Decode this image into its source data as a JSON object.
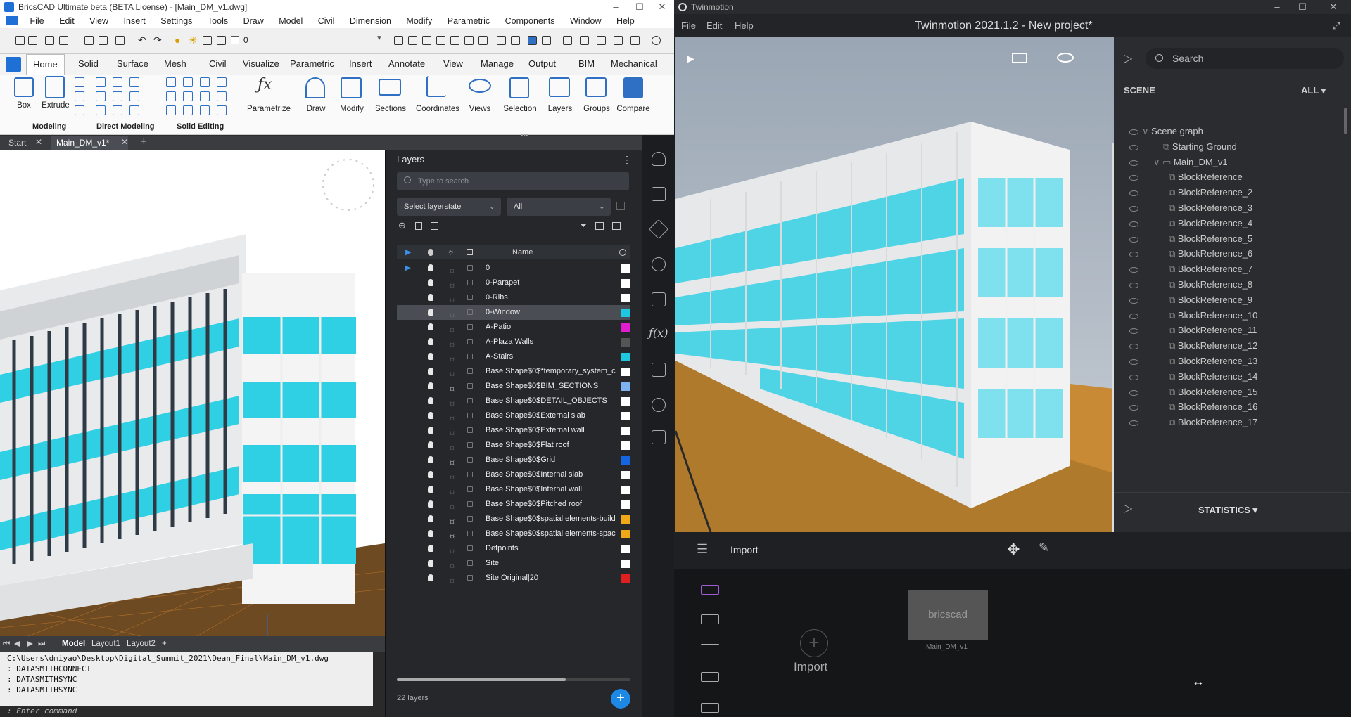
{
  "bricscad": {
    "title": "BricsCAD Ultimate beta (BETA License) - [Main_DM_v1.dwg]",
    "menu": [
      "File",
      "Edit",
      "View",
      "Insert",
      "Settings",
      "Tools",
      "Draw",
      "Model",
      "Civil",
      "Dimension",
      "Modify",
      "Parametric",
      "Components",
      "Window",
      "Help"
    ],
    "qat_layer": "0",
    "tabs": [
      "Home",
      "Solid",
      "Surface",
      "Mesh",
      "Civil",
      "Visualize",
      "Parametric",
      "Insert",
      "Annotate",
      "View",
      "Manage",
      "Output",
      "BIM",
      "Mechanical"
    ],
    "ribbon": {
      "box": "Box",
      "extrude": "Extrude",
      "parametrize": "Parametrize",
      "draw": "Draw",
      "modify": "Modify",
      "sections": "Sections",
      "coordinates": "Coordinates",
      "views": "Views",
      "selection": "Selection",
      "layers": "Layers",
      "groups": "Groups",
      "compare": "Compare",
      "group_modeling": "Modeling",
      "group_direct": "Direct Modeling",
      "group_solid": "Solid Editing"
    },
    "doc_tabs": [
      "Start",
      "Main_DM_v1*"
    ],
    "layout_tabs": [
      "Model",
      "Layout1",
      "Layout2"
    ],
    "command_history": [
      "C:\\Users\\dmiyao\\Desktop\\Digital_Summit_2021\\Dean_Final\\Main_DM_v1.dwg",
      ": DATASMITHCONNECT",
      ": DATASMITHSYNC",
      ": DATASMITHSYNC"
    ],
    "command_placeholder": ": Enter command"
  },
  "layers_panel": {
    "title": "Layers",
    "search_placeholder": "Type to search",
    "layerstate": "Select layerstate",
    "filter": "All",
    "name_header": "Name",
    "count": "22 layers",
    "rows": [
      {
        "name": "0",
        "color": "#ffffff",
        "frozen": false
      },
      {
        "name": "0-Parapet",
        "color": "#ffffff",
        "frozen": false
      },
      {
        "name": "0-Ribs",
        "color": "#ffffff",
        "frozen": false
      },
      {
        "name": "0-Window",
        "color": "#1ec8e0",
        "frozen": false,
        "selected": true
      },
      {
        "name": "A-Patio",
        "color": "#e01ed0",
        "frozen": false
      },
      {
        "name": "A-Plaza Walls",
        "color": "#555555",
        "frozen": false
      },
      {
        "name": "A-Stairs",
        "color": "#1ec8e0",
        "frozen": false
      },
      {
        "name": "Base Shape$0$*temporary_system_c",
        "color": "#ffffff",
        "frozen": false
      },
      {
        "name": "Base Shape$0$BIM_SECTIONS",
        "color": "#7fb2f0",
        "frozen": true
      },
      {
        "name": "Base Shape$0$DETAIL_OBJECTS",
        "color": "#ffffff",
        "frozen": false
      },
      {
        "name": "Base Shape$0$External slab",
        "color": "#ffffff",
        "frozen": false
      },
      {
        "name": "Base Shape$0$External wall",
        "color": "#ffffff",
        "frozen": false
      },
      {
        "name": "Base Shape$0$Flat roof",
        "color": "#ffffff",
        "frozen": false
      },
      {
        "name": "Base Shape$0$Grid",
        "color": "#1565e0",
        "frozen": true
      },
      {
        "name": "Base Shape$0$Internal slab",
        "color": "#ffffff",
        "frozen": false
      },
      {
        "name": "Base Shape$0$Internal wall",
        "color": "#ffffff",
        "frozen": false
      },
      {
        "name": "Base Shape$0$Pitched roof",
        "color": "#ffffff",
        "frozen": false
      },
      {
        "name": "Base Shape$0$spatial elements-build",
        "color": "#f0a818",
        "frozen": true
      },
      {
        "name": "Base Shape$0$spatial elements-spac",
        "color": "#f0a818",
        "frozen": true
      },
      {
        "name": "Defpoints",
        "color": "#ffffff",
        "frozen": false
      },
      {
        "name": "Site",
        "color": "#ffffff",
        "frozen": false
      },
      {
        "name": "Site Original|20",
        "color": "#e02020",
        "frozen": false
      }
    ]
  },
  "twinmotion": {
    "window_title": "Twinmotion",
    "menu": [
      "File",
      "Edit",
      "Help"
    ],
    "project_title": "Twinmotion 2021.1.2 - New project*",
    "search_placeholder": "Search",
    "scene_label": "SCENE",
    "scene_filter": "ALL",
    "scene_graph": "Scene graph",
    "starting_ground": "Starting Ground",
    "main_group": "Main_DM_v1",
    "block_refs": [
      "BlockReference",
      "BlockReference_2",
      "BlockReference_3",
      "BlockReference_4",
      "BlockReference_5",
      "BlockReference_6",
      "BlockReference_7",
      "BlockReference_8",
      "BlockReference_9",
      "BlockReference_10",
      "BlockReference_11",
      "BlockReference_12",
      "BlockReference_13",
      "BlockReference_14",
      "BlockReference_15",
      "BlockReference_16",
      "BlockReference_17"
    ],
    "statistics": "STATISTICS",
    "import_title": "Import",
    "import_button": "Import",
    "tile_label": "bricscad",
    "tile_caption": "Main_DM_v1"
  },
  "colors": {
    "window_cyan": "#2fd0e4",
    "accent_blue": "#1e88e5",
    "ground_orange": "#c88a34"
  }
}
